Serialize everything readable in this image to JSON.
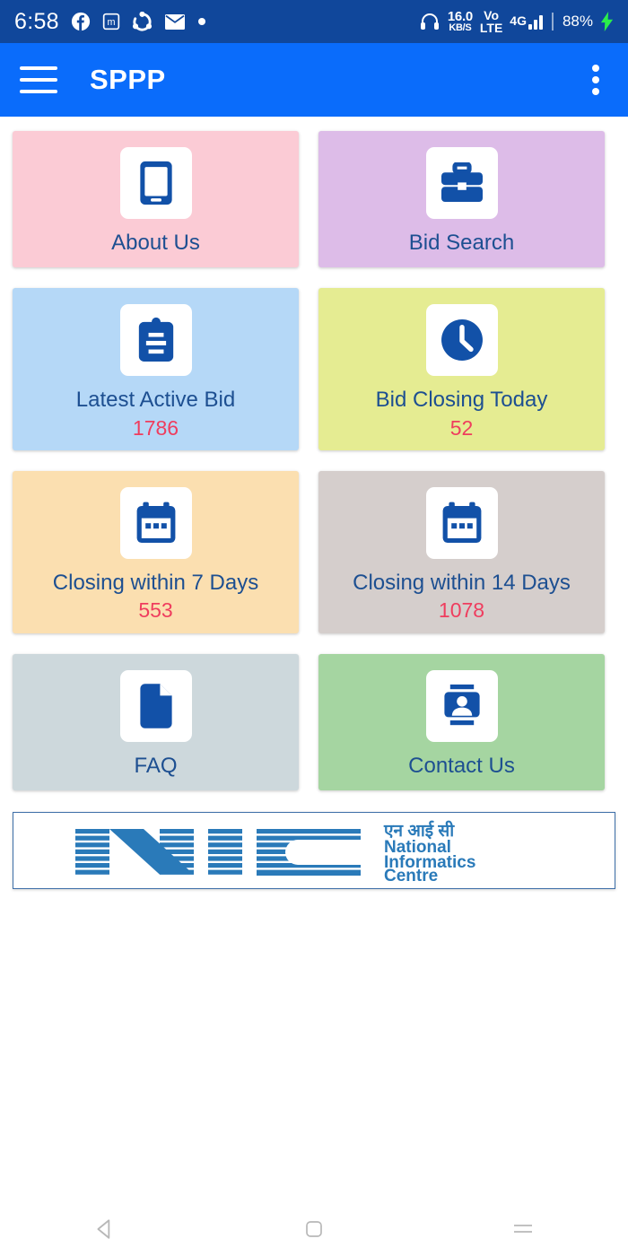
{
  "status_bar": {
    "clock": "6:58",
    "left_icons": [
      "facebook-icon",
      "m-badge-icon",
      "sync-icon",
      "mail-icon",
      "dot-icon"
    ],
    "network_speed_value": "16.0",
    "network_speed_unit": "KB/S",
    "volte_line1": "Vo",
    "volte_line2": "LTE",
    "signal_label": "4G",
    "battery": "88%",
    "charging_icon": "bolt-icon",
    "headset_icon": "headset-icon",
    "background": "#10479b"
  },
  "app_bar": {
    "menu_icon": "hamburger-menu-icon",
    "title": "SPPP",
    "overflow_icon": "more-vertical-icon",
    "background": "#0a6cfb"
  },
  "grid": {
    "cards": [
      {
        "id": "about-us",
        "label": "About Us",
        "count": "",
        "icon": "smartphone-icon",
        "bg": "#fbcbd5"
      },
      {
        "id": "bid-search",
        "label": "Bid Search",
        "count": "",
        "icon": "briefcase-icon",
        "bg": "#ddbce8"
      },
      {
        "id": "latest-active-bid",
        "label": "Latest Active Bid",
        "count": "1786",
        "icon": "clipboard-icon",
        "bg": "#b5d8f7"
      },
      {
        "id": "bid-closing-today",
        "label": "Bid Closing Today",
        "count": "52",
        "icon": "clock-icon",
        "bg": "#e5ec92"
      },
      {
        "id": "closing-within-7-days",
        "label": "Closing within 7 Days",
        "count": "553",
        "icon": "calendar-icon",
        "bg": "#fbdfb0"
      },
      {
        "id": "closing-within-14-days",
        "label": "Closing within 14 Days",
        "count": "1078",
        "icon": "calendar-icon",
        "bg": "#d5cecc"
      },
      {
        "id": "faq",
        "label": "FAQ",
        "count": "",
        "icon": "document-icon",
        "bg": "#cdd8dc"
      },
      {
        "id": "contact-us",
        "label": "Contact Us",
        "count": "",
        "icon": "contact-card-icon",
        "bg": "#a5d5a1"
      }
    ]
  },
  "footer_banner": {
    "logo_text": "NIC",
    "hindi_text": "एन आई सी",
    "line1": "National",
    "line2": "Informatics",
    "line3": "Centre",
    "color": "#2a7ab9"
  },
  "nav_bar": {
    "back_icon": "back-triangle-icon",
    "home_icon": "home-square-icon",
    "recents_icon": "recents-lines-icon"
  },
  "colors": {
    "label_blue": "#1d4f91",
    "count_red": "#ef3d5e",
    "icon_blue": "#1251a8"
  }
}
